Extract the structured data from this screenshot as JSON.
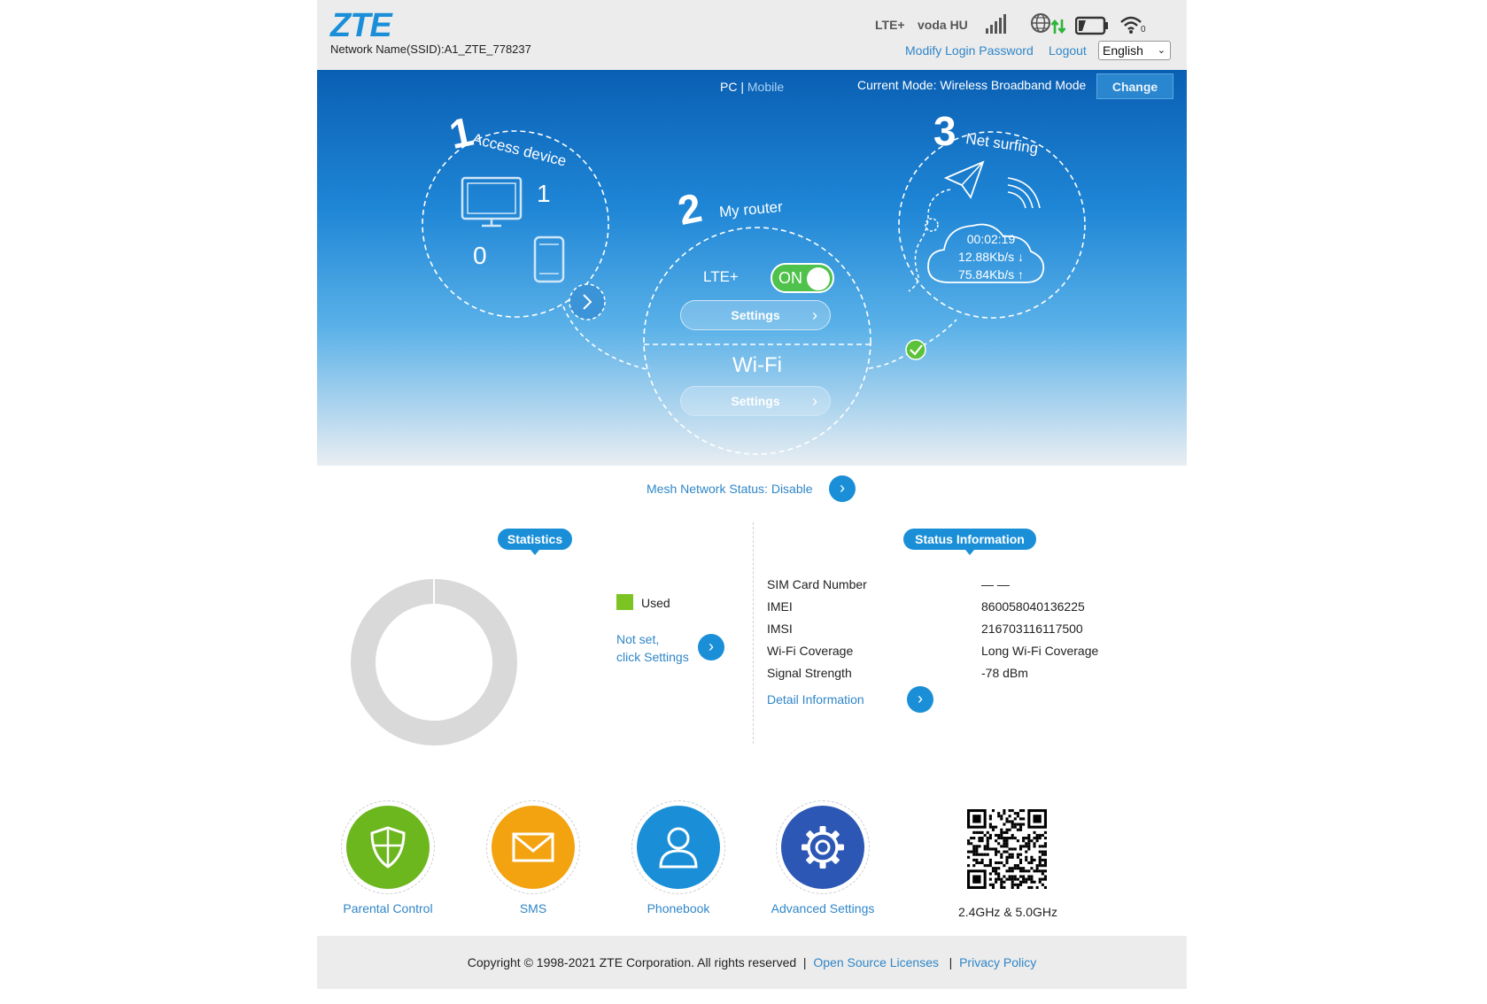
{
  "header": {
    "logo": "ZTE",
    "ssid": "Network Name(SSID):A1_ZTE_778237",
    "network_type": "LTE+",
    "carrier": "voda HU",
    "wifi_clients": "0",
    "modify_password": "Modify Login Password",
    "logout": "Logout",
    "language": "English"
  },
  "hero": {
    "pc": "PC |",
    "mobile": "Mobile",
    "current_mode": "Current Mode: Wireless Broadband Mode",
    "change": "Change",
    "step1": {
      "number": "1",
      "title": "Access device",
      "pc_count": "1",
      "mobile_count": "0"
    },
    "step2": {
      "number": "2",
      "title": "My router",
      "lte_label": "LTE+",
      "toggle": "ON",
      "settings1": "Settings",
      "wifi_label": "Wi-Fi",
      "settings2": "Settings"
    },
    "step3": {
      "number": "3",
      "title": "Net surfing",
      "duration": "00:02:19",
      "down": "12.88Kb/s ↓",
      "up": "75.84Kb/s ↑"
    }
  },
  "mesh": {
    "label": "Mesh Network Status: Disable"
  },
  "statistics": {
    "tag": "Statistics",
    "used_fraction": 0,
    "legend_used": "Used",
    "not_set_line1": "Not set,",
    "not_set_line2": "click Settings"
  },
  "status": {
    "tag": "Status Information",
    "rows": [
      {
        "label": "SIM Card Number",
        "value": "— —"
      },
      {
        "label": "IMEI",
        "value": "860058040136225"
      },
      {
        "label": "IMSI",
        "value": "216703116117500"
      },
      {
        "label": "Wi-Fi Coverage",
        "value": "Long Wi-Fi Coverage"
      },
      {
        "label": "Signal Strength",
        "value": "-78 dBm"
      }
    ],
    "detail": "Detail Information"
  },
  "shortcuts": [
    {
      "label": "Parental Control",
      "color": "#6cb61e",
      "icon": "shield-icon"
    },
    {
      "label": "SMS",
      "color": "#f2a30f",
      "icon": "envelope-icon"
    },
    {
      "label": "Phonebook",
      "color": "#1a8fd8",
      "icon": "person-icon"
    },
    {
      "label": "Advanced Settings",
      "color": "#2d57b5",
      "icon": "gear-icon"
    }
  ],
  "qr": {
    "caption": "2.4GHz & 5.0GHz"
  },
  "footer": {
    "copyright": "Copyright © 1998-2021 ZTE Corporation. All rights reserved",
    "open_source": "Open Source Licenses",
    "privacy": "Privacy Policy"
  },
  "colors": {
    "accent": "#1a8fd8",
    "green": "#4ec24a",
    "header_bg": "#ececec"
  }
}
